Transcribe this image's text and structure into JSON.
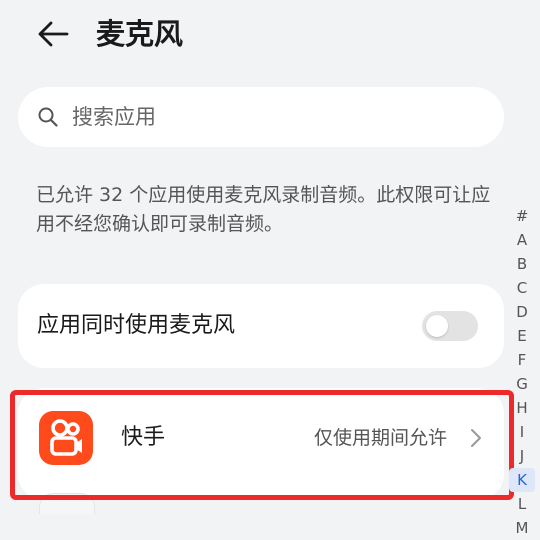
{
  "header": {
    "back_icon": "back-arrow-icon",
    "title": "麦克风"
  },
  "search": {
    "icon": "search-icon",
    "placeholder": "搜索应用",
    "value": ""
  },
  "description": "已允许 32 个应用使用麦克风录制音频。此权限可让应用不经您确认即可录制音频。",
  "simultaneous": {
    "label": "应用同时使用麦克风",
    "enabled": false
  },
  "apps": [
    {
      "name": "快手",
      "status": "仅使用期间允许",
      "icon": "kuaishou-icon",
      "icon_color": "#ff4a1c"
    }
  ],
  "highlight_color": "#ec2a2a",
  "alphabet_index": [
    "#",
    "A",
    "B",
    "C",
    "D",
    "E",
    "F",
    "G",
    "H",
    "I",
    "J",
    "K",
    "L",
    "M"
  ],
  "alphabet_active": "K",
  "accent_color": "#2a63d9"
}
